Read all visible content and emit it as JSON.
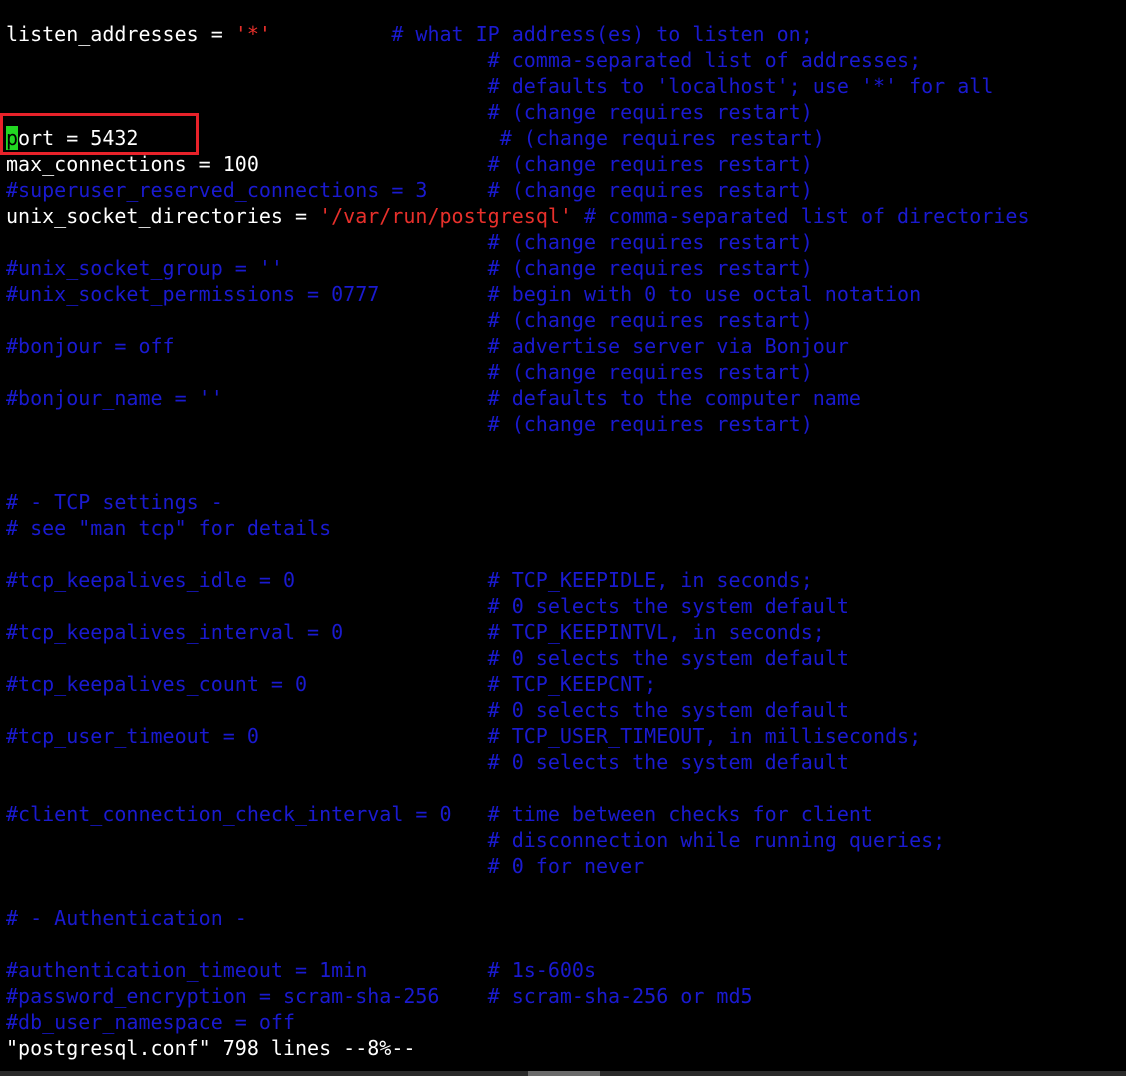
{
  "window": {
    "app": "vim",
    "file_name": "postgresql.conf"
  },
  "editor": {
    "lines": [
      [
        {
          "s": "t",
          "v": "listen_addresses = "
        },
        {
          "s": "str",
          "v": "'*'"
        },
        {
          "s": "c",
          "v": "          # what IP address(es) to listen on;"
        }
      ],
      [
        {
          "s": "c",
          "v": "                                        # comma-separated list of addresses;"
        }
      ],
      [
        {
          "s": "c",
          "v": "                                        # defaults to 'localhost'; use '*' for all"
        }
      ],
      [
        {
          "s": "c",
          "v": "                                        # (change requires restart)"
        }
      ],
      [
        {
          "s": "cursor",
          "v": "p"
        },
        {
          "s": "t",
          "v": "ort = 5432"
        },
        {
          "s": "c",
          "v": "                              # (change requires restart)"
        }
      ],
      [
        {
          "s": "t",
          "v": "max_connections = 100"
        },
        {
          "s": "c",
          "v": "                   # (change requires restart)"
        }
      ],
      [
        {
          "s": "c",
          "v": "#superuser_reserved_connections = 3     # (change requires restart)"
        }
      ],
      [
        {
          "s": "t",
          "v": "unix_socket_directories = "
        },
        {
          "s": "str",
          "v": "'/var/run/postgresql'"
        },
        {
          "s": "c",
          "v": " # comma-separated list of directories"
        }
      ],
      [
        {
          "s": "c",
          "v": "                                        # (change requires restart)"
        }
      ],
      [
        {
          "s": "c",
          "v": "#unix_socket_group = ''                 # (change requires restart)"
        }
      ],
      [
        {
          "s": "c",
          "v": "#unix_socket_permissions = 0777         # begin with 0 to use octal notation"
        }
      ],
      [
        {
          "s": "c",
          "v": "                                        # (change requires restart)"
        }
      ],
      [
        {
          "s": "c",
          "v": "#bonjour = off                          # advertise server via Bonjour"
        }
      ],
      [
        {
          "s": "c",
          "v": "                                        # (change requires restart)"
        }
      ],
      [
        {
          "s": "c",
          "v": "#bonjour_name = ''                      # defaults to the computer name"
        }
      ],
      [
        {
          "s": "c",
          "v": "                                        # (change requires restart)"
        }
      ],
      [],
      [],
      [
        {
          "s": "c",
          "v": "# - TCP settings -"
        }
      ],
      [
        {
          "s": "c",
          "v": "# see \"man tcp\" for details"
        }
      ],
      [],
      [
        {
          "s": "c",
          "v": "#tcp_keepalives_idle = 0                # TCP_KEEPIDLE, in seconds;"
        }
      ],
      [
        {
          "s": "c",
          "v": "                                        # 0 selects the system default"
        }
      ],
      [
        {
          "s": "c",
          "v": "#tcp_keepalives_interval = 0            # TCP_KEEPINTVL, in seconds;"
        }
      ],
      [
        {
          "s": "c",
          "v": "                                        # 0 selects the system default"
        }
      ],
      [
        {
          "s": "c",
          "v": "#tcp_keepalives_count = 0               # TCP_KEEPCNT;"
        }
      ],
      [
        {
          "s": "c",
          "v": "                                        # 0 selects the system default"
        }
      ],
      [
        {
          "s": "c",
          "v": "#tcp_user_timeout = 0                   # TCP_USER_TIMEOUT, in milliseconds;"
        }
      ],
      [
        {
          "s": "c",
          "v": "                                        # 0 selects the system default"
        }
      ],
      [],
      [
        {
          "s": "c",
          "v": "#client_connection_check_interval = 0   # time between checks for client"
        }
      ],
      [
        {
          "s": "c",
          "v": "                                        # disconnection while running queries;"
        }
      ],
      [
        {
          "s": "c",
          "v": "                                        # 0 for never"
        }
      ],
      [],
      [
        {
          "s": "c",
          "v": "# - Authentication -"
        }
      ],
      [],
      [
        {
          "s": "c",
          "v": "#authentication_timeout = 1min          # 1s-600s"
        }
      ],
      [
        {
          "s": "c",
          "v": "#password_encryption = scram-sha-256    # scram-sha-256 or md5"
        }
      ],
      [
        {
          "s": "c",
          "v": "#db_user_namespace = off"
        }
      ]
    ]
  },
  "status_bar": {
    "text": "\"postgresql.conf\" 798 lines --8%--"
  },
  "colors": {
    "background": "#000000",
    "text": "#ffffff",
    "comment": "#1a1ad0",
    "string": "#e8302b",
    "cursor": "#22d822",
    "highlight_box": "#e8222a"
  }
}
